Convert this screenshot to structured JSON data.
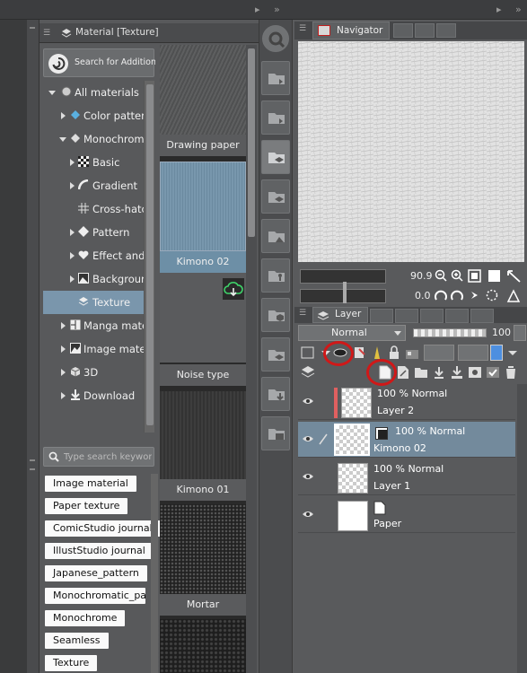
{
  "material_panel": {
    "tab_title": "Material [Texture]",
    "search_additional_label": "Search for Additional M",
    "tree": [
      {
        "label": "All materials",
        "indent": 0,
        "expanded": true
      },
      {
        "label": "Color pattern",
        "indent": 1
      },
      {
        "label": "Monochromatic",
        "indent": 1,
        "expanded": true
      },
      {
        "label": "Basic",
        "indent": 2
      },
      {
        "label": "Gradient",
        "indent": 2
      },
      {
        "label": "Cross-hatching",
        "indent": 2
      },
      {
        "label": "Pattern",
        "indent": 2
      },
      {
        "label": "Effect and frame",
        "indent": 2
      },
      {
        "label": "Background",
        "indent": 2
      },
      {
        "label": "Texture",
        "indent": 2,
        "selected": true
      },
      {
        "label": "Manga material",
        "indent": 1
      },
      {
        "label": "Image material",
        "indent": 1
      },
      {
        "label": "3D",
        "indent": 1
      },
      {
        "label": "Download",
        "indent": 1
      }
    ],
    "keyword_search_placeholder": "Type search keywords",
    "tags": [
      "Image material",
      "Paper texture",
      "ComicStudio journal",
      "IllustStudio journal",
      "Japanese_pattern",
      "Monochromatic_pattern",
      "Monochrome",
      "Seamless",
      "Texture"
    ],
    "thumbnails": [
      {
        "label": "Drawing paper",
        "color": "#555657"
      },
      {
        "label": "Kimono 02",
        "color": "#6d8fa6"
      },
      {
        "label": "Noise type",
        "color": "#5a5a5a"
      },
      {
        "label": "Kimono 01",
        "color": "#3a3a3a"
      },
      {
        "label": "Mortar",
        "color": "#2a2a2a"
      }
    ]
  },
  "navigator": {
    "tab_title": "Navigator",
    "zoom": "90.9",
    "rotation": "0.0"
  },
  "layer_panel": {
    "tab_title": "Layer",
    "blend_mode": "Normal",
    "opacity": "100",
    "layers": [
      {
        "mode": "100 % Normal",
        "name": "Layer 2",
        "selected": false,
        "marker": true
      },
      {
        "mode": "100 % Normal",
        "name": "Kimono 02",
        "selected": true
      },
      {
        "mode": "100 % Normal",
        "name": "Layer 1",
        "selected": false
      },
      {
        "mode": "",
        "name": "Paper",
        "selected": false
      }
    ]
  },
  "colors": {
    "selection": "#7a96ac",
    "highlight_ring": "#d01818"
  }
}
